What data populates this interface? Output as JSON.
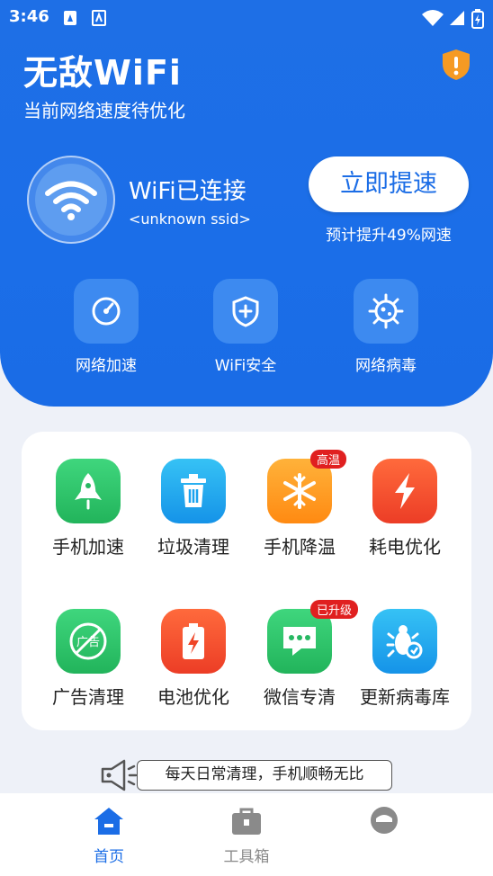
{
  "status_bar": {
    "time": "3:46"
  },
  "header": {
    "title": "无敌WiFi",
    "subtitle": "当前网络速度待优化"
  },
  "connection": {
    "status": "WiFi已连接",
    "ssid": "<unknown ssid>"
  },
  "boost": {
    "button_label": "立即提速",
    "note": "预计提升49%网速"
  },
  "quick_actions": [
    {
      "label": "网络加速",
      "icon": "speedometer-icon"
    },
    {
      "label": "WiFi安全",
      "icon": "shield-plus-icon"
    },
    {
      "label": "网络病毒",
      "icon": "virus-icon"
    }
  ],
  "tools": [
    {
      "label": "手机加速",
      "icon": "rocket-icon",
      "badge": "",
      "color": "#2ec26a"
    },
    {
      "label": "垃圾清理",
      "icon": "trash-icon",
      "badge": "",
      "color": "#1fa8f0"
    },
    {
      "label": "手机降温",
      "icon": "snowflake-icon",
      "badge": "高温",
      "color": "#ff9b1a"
    },
    {
      "label": "耗电优化",
      "icon": "lightning-icon",
      "badge": "",
      "color": "#f2502e"
    },
    {
      "label": "广告清理",
      "icon": "no-ads-icon",
      "badge": "",
      "color": "#2ec26a"
    },
    {
      "label": "电池优化",
      "icon": "battery-icon",
      "badge": "",
      "color": "#f2502e"
    },
    {
      "label": "微信专清",
      "icon": "chat-icon",
      "badge": "已升级",
      "color": "#2ec26a"
    },
    {
      "label": "更新病毒库",
      "icon": "bug-refresh-icon",
      "badge": "",
      "color": "#1fa8f0"
    }
  ],
  "tip": {
    "text": "每天日常清理，手机顺畅无比"
  },
  "tabs": [
    {
      "label": "首页",
      "icon": "home-icon",
      "active": true
    },
    {
      "label": "工具箱",
      "icon": "toolbox-icon",
      "active": false
    },
    {
      "label": "",
      "icon": "profile-icon",
      "active": false
    }
  ],
  "colors": {
    "primary": "#1b6ee8",
    "active_tab": "#1b6de6",
    "inactive_tab": "#8a8a8a"
  }
}
